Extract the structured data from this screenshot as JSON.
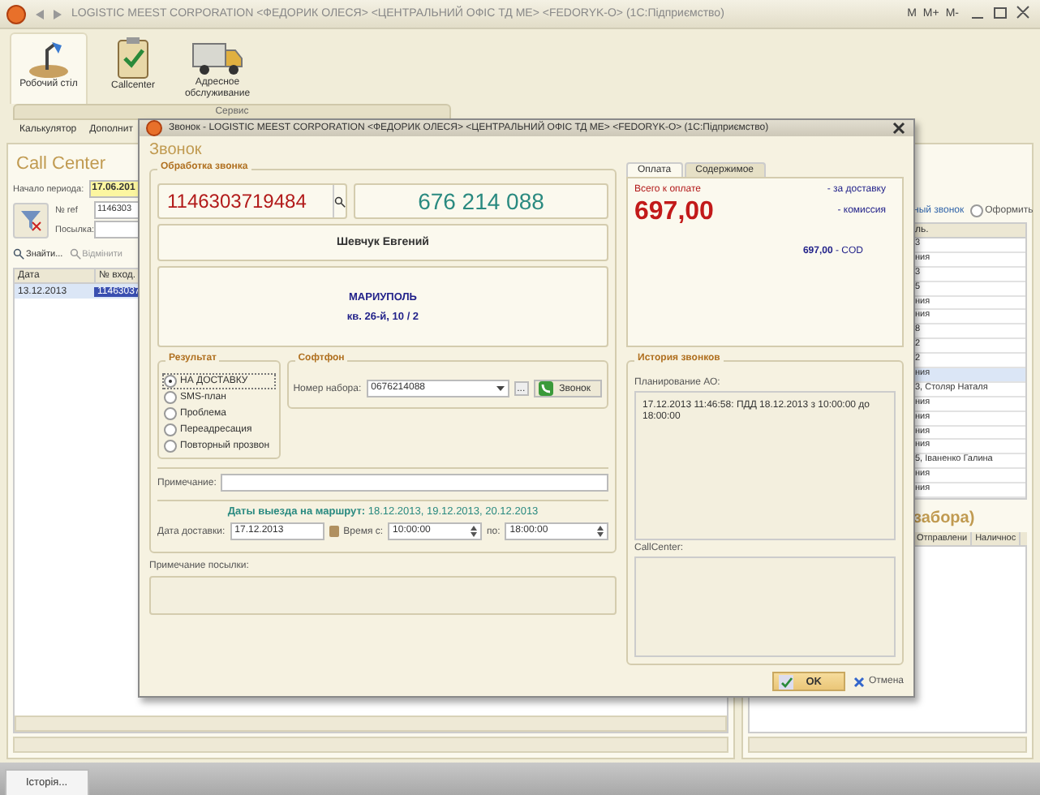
{
  "main_window": {
    "title": "LOGISTIC MEEST CORPORATION   <ФЕДОРИК ОЛЕСЯ>  <ЦЕНТРАЛЬНИЙ ОФІС ТД МЕ>  <FEDORYK-O>  (1С:Підприємство)",
    "memory_buttons": [
      "M",
      "M+",
      "M-"
    ]
  },
  "ribbon": [
    {
      "label": "Робочий стіл",
      "kind": "desk",
      "selected": true
    },
    {
      "label": "Callcenter",
      "kind": "clipboard",
      "selected": false
    },
    {
      "label": "Адресное обслуживание",
      "kind": "truck",
      "selected": false
    }
  ],
  "service_group": {
    "title": "Сервис",
    "items": [
      "Калькулятор",
      "Дополнит"
    ]
  },
  "call_center": {
    "title": "Call Center",
    "period_label": "Начало периода:",
    "period_value": "17.06.201",
    "ref_label": "№ ref",
    "ref_value": "1146303",
    "parcel_label": "Посылка:",
    "find_button": "Знайти...",
    "cancel_button": "Відмінити",
    "columns": [
      "Дата",
      "№ вход."
    ],
    "rows": [
      {
        "cells": [
          "13.12.2013",
          "11463037"
        ],
        "selected": true
      }
    ]
  },
  "right_panel": {
    "radio_1": "ный звонок",
    "radio_2": {
      "label": "Оформить",
      "selected": false
    },
    "column_1": "ль.",
    "rows": [
      {
        "text": "3",
        "selected": false
      },
      {
        "text": "ния",
        "selected": false
      },
      {
        "text": "3",
        "selected": false
      },
      {
        "text": "5",
        "selected": false
      },
      {
        "text": "ния",
        "selected": false
      },
      {
        "text": "ния",
        "selected": false
      },
      {
        "text": "8",
        "selected": false
      },
      {
        "text": "2",
        "selected": false
      },
      {
        "text": "2",
        "selected": false
      },
      {
        "text": "ния",
        "selected": true
      },
      {
        "text": "3, Столяр Наталя",
        "selected": false
      },
      {
        "text": "ния",
        "selected": false
      },
      {
        "text": "ния",
        "selected": false
      },
      {
        "text": "ния",
        "selected": false
      },
      {
        "text": "ния",
        "selected": false
      },
      {
        "text": "5, Іваненко Галина",
        "selected": false
      },
      {
        "text": "ния",
        "selected": false
      },
      {
        "text": "ния",
        "selected": false
      }
    ],
    "heading": "забора)",
    "columns": [
      "Отправлени",
      "Наличнос"
    ]
  },
  "dialog": {
    "title": "Звонок - LOGISTIC MEEST CORPORATION   <ФЕДОРИК ОЛЕСЯ>  <ЦЕНТРАЛЬНИЙ ОФІС ТД МЕ>  <FEDORYK-O>  (1С:Підприємство)",
    "heading": "Звонок",
    "processing_group": "Обработка звонка",
    "ref_number": "1146303719484",
    "phone": "676 214 088",
    "recipient": "Шевчук Евгений",
    "city": "МАРИУПОЛЬ",
    "address": "кв. 26-й, 10 / 2",
    "result_group": "Результат",
    "results": [
      {
        "label": "НА ДОСТАВКУ",
        "selected": true
      },
      {
        "label": "SMS-план",
        "selected": false
      },
      {
        "label": "Проблема",
        "selected": false
      },
      {
        "label": "Переадресация",
        "selected": false
      },
      {
        "label": "Повторный прозвон",
        "selected": false
      }
    ],
    "softphone_group": "Софтфон",
    "dial_label": "Номер набора:",
    "dial_value": "0676214088",
    "more_button": "...",
    "call_button": "Звонок",
    "note_label": "Примечание:",
    "route_dates": "**Даты выезда на маршрут:** 18.12.2013, 19.12.2013, 20.12.2013",
    "delivery_date_label": "Дата доставки:",
    "delivery_date": "17.12.2013",
    "time_from_label": "Время с:",
    "time_from": "10:00:00",
    "time_to_label": "по:",
    "time_to": "18:00:00",
    "parcel_note_label": "Примечание посылки:",
    "tabs": [
      {
        "label": "Оплата",
        "selected": true
      },
      {
        "label": "Содержимое",
        "selected": false
      }
    ],
    "total_label": "Всего к оплате",
    "total": "697,00",
    "delivery_fee_label": "- за доставку",
    "commission_label": "- комиссия",
    "cod": "**697,00** - COD",
    "history_group": "История звонков",
    "planning_label": "Планирование АО:",
    "planning_text": "17.12.2013 11:46:58: ПДД 18.12.2013 з 10:00:00 до 18:00:00",
    "callcenter_label": "CallCenter:",
    "ok_button": "OK",
    "cancel_button": "Отмена"
  },
  "taskbar": {
    "item": "Історія..."
  }
}
